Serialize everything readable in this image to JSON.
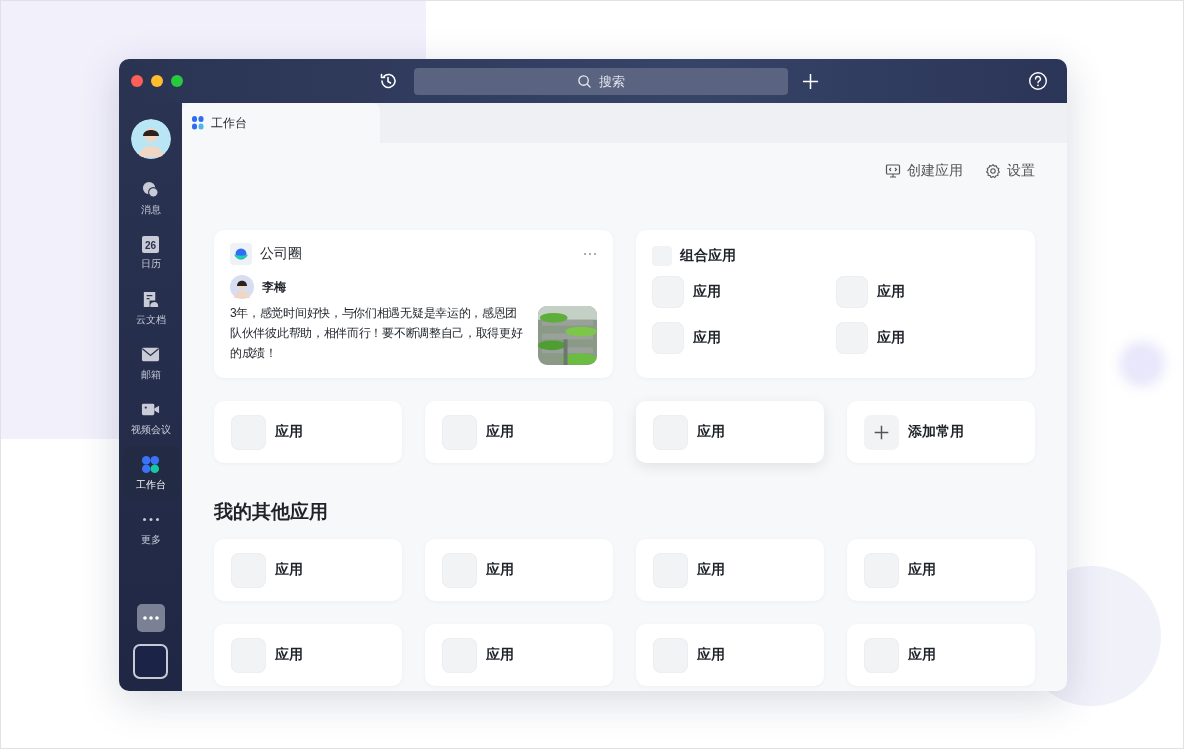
{
  "window": {
    "search_placeholder": "搜索"
  },
  "sidebar": {
    "items": [
      {
        "kind": "chat",
        "label": "消息",
        "selected": false
      },
      {
        "kind": "calendar",
        "label": "日历",
        "badge": "26",
        "selected": false
      },
      {
        "kind": "doc",
        "label": "云文档",
        "selected": false
      },
      {
        "kind": "mail",
        "label": "邮箱",
        "selected": false
      },
      {
        "kind": "video",
        "label": "视频会议",
        "selected": false
      },
      {
        "kind": "apps",
        "label": "工作台",
        "selected": true
      },
      {
        "kind": "more",
        "label": "更多",
        "selected": false
      }
    ]
  },
  "tabs": [
    {
      "label": "工作台",
      "selected": true
    }
  ],
  "toolbar": [
    {
      "kind": "create",
      "label": "创建应用"
    },
    {
      "kind": "settings",
      "label": "设置"
    }
  ],
  "company_circle": {
    "title": "公司圈",
    "author": "李梅",
    "text": "3年，感觉时间好快，与你们相遇无疑是幸运的，感恩团队伙伴彼此帮助，相伴而行！要不断调整自己，取得更好的成绩！"
  },
  "combo_apps": {
    "title": "组合应用",
    "apps": [
      "应用",
      "应用",
      "应用",
      "应用"
    ]
  },
  "common_apps": [
    {
      "kind": "app",
      "label": "应用"
    },
    {
      "kind": "app",
      "label": "应用"
    },
    {
      "kind": "app",
      "label": "应用"
    },
    {
      "kind": "add",
      "label": "添加常用"
    }
  ],
  "other_apps": {
    "heading": "我的其他应用",
    "apps": [
      "应用",
      "应用",
      "应用",
      "应用",
      "应用",
      "应用",
      "应用",
      "应用"
    ]
  }
}
